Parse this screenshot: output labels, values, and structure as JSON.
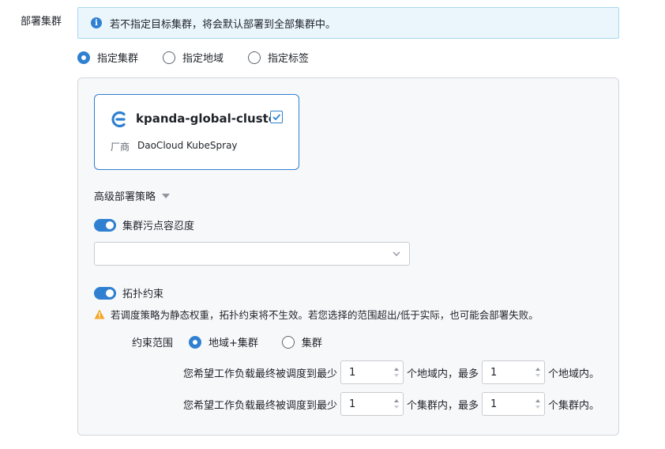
{
  "field_label": "部署集群",
  "info": {
    "icon": "info-icon",
    "text": "若不指定目标集群，将会默认部署到全部集群中。"
  },
  "target_options": [
    {
      "label": "指定集群",
      "selected": true
    },
    {
      "label": "指定地域",
      "selected": false
    },
    {
      "label": "指定标签",
      "selected": false
    }
  ],
  "cluster_card": {
    "name": "kpanda-global-cluster",
    "checked": true,
    "vendor_key": "厂商",
    "vendor_value": "DaoCloud KubeSpray"
  },
  "advanced": {
    "title": "高级部署策略",
    "taint_toggle": {
      "label": "集群污点容忍度",
      "enabled": true
    },
    "taint_select": {
      "value": ""
    },
    "topology_toggle": {
      "label": "拓扑约束",
      "enabled": true
    },
    "warning": "若调度策略为静态权重，拓扑约束将不生效。若您选择的范围超出/低于实际，也可能会部署失败。",
    "scope": {
      "label": "约束范围",
      "options": [
        {
          "label": "地域+集群",
          "selected": true
        },
        {
          "label": "集群",
          "selected": false
        }
      ]
    },
    "region_row": {
      "prefix": "您希望工作负载最终被调度到最少",
      "min": "1",
      "mid": "个地域内，最多",
      "max": "1",
      "suffix": "个地域内。"
    },
    "cluster_row": {
      "prefix": "您希望工作负载最终被调度到最少",
      "min": "1",
      "mid": "个集群内，最多",
      "max": "1",
      "suffix": "个集群内。"
    }
  },
  "colors": {
    "accent": "#2f80d1",
    "warning": "#f5a623",
    "info_bg": "#eaf6fc"
  }
}
